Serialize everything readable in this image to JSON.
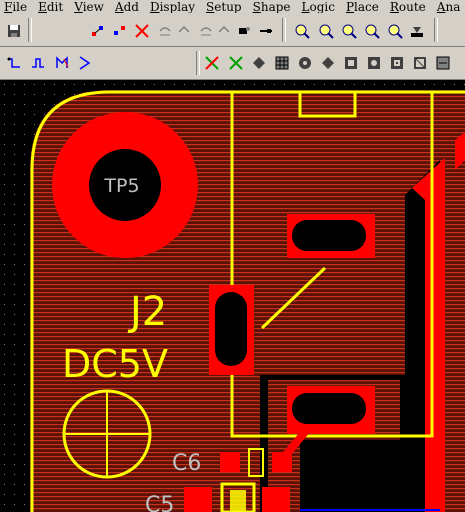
{
  "menu": {
    "items": [
      {
        "label": "File",
        "ul": "F",
        "rest": "ile"
      },
      {
        "label": "Edit",
        "ul": "E",
        "rest": "dit"
      },
      {
        "label": "View",
        "ul": "V",
        "rest": "iew"
      },
      {
        "label": "Add",
        "ul": "A",
        "rest": "dd"
      },
      {
        "label": "Display",
        "ul": "D",
        "rest": "isplay"
      },
      {
        "label": "Setup",
        "ul": "S",
        "rest": "etup"
      },
      {
        "label": "Shape",
        "ul": "S",
        "rest": "hape"
      },
      {
        "label": "Logic",
        "ul": "L",
        "rest": "ogic"
      },
      {
        "label": "Place",
        "ul": "P",
        "rest": "lace"
      },
      {
        "label": "Route",
        "ul": "R",
        "rest": "oute"
      },
      {
        "label": "Ana",
        "ul": "A",
        "rest": "na"
      }
    ]
  },
  "toolbar1": {
    "icons": [
      "save-icon",
      "add-connect-icon",
      "add-via-icon",
      "delete-icon",
      "undo-icon",
      "redo-icon",
      "slide-icon",
      "fanout-icon",
      "zoom-in-icon",
      "zoom-out-icon",
      "zoom-fit-icon",
      "zoom-previous-icon",
      "zoom-selection-icon",
      "redraw-icon"
    ]
  },
  "toolbar2": {
    "icons": [
      "route-icon",
      "square-route-icon",
      "fanout-net-icon",
      "triangle-icon",
      "ratsnest-icon",
      "unrats-icon",
      "shape-icon",
      "grid-icon",
      "pad-icon",
      "via-icon",
      "copper-icon",
      "keepout-icon",
      "text-icon",
      "board-icon",
      "dimension-icon"
    ]
  },
  "board": {
    "labels": {
      "tp5": "TP5",
      "j2": "J2",
      "dc5v": "DC5V",
      "c6": "C6",
      "c5": "C5"
    },
    "colors": {
      "copper": "#ff0000",
      "copper_fill": "#7a1a10",
      "silkscreen": "#ffff00",
      "via_hole": "#000000",
      "ref_text": "#c0c0c0",
      "background": "#000000"
    }
  }
}
